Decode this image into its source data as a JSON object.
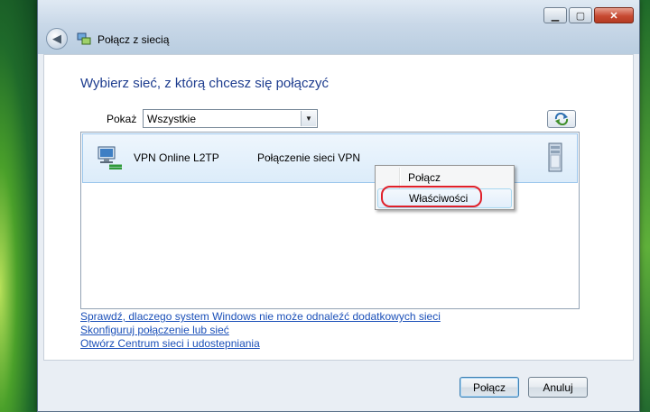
{
  "window": {
    "title": "Połącz z siecią",
    "controls": {
      "minimize": "▁",
      "maximize": "▢",
      "close": "✕"
    }
  },
  "heading": "Wybierz sieć, z którą chcesz się połączyć",
  "filter": {
    "label": "Pokaż",
    "selected": "Wszystkie"
  },
  "networks": [
    {
      "name": "VPN Online L2TP",
      "type": "Połączenie sieci VPN",
      "icon": "vpn-connection-icon"
    }
  ],
  "context_menu": {
    "items": [
      "Połącz",
      "Właściwości"
    ],
    "highlighted": "Właściwości"
  },
  "links": [
    "Sprawdź, dlaczego system Windows nie może odnaleźć dodatkowych sieci",
    "Skonfiguruj połączenie lub sieć",
    "Otwórz Centrum sieci i udostepniania"
  ],
  "buttons": {
    "connect": "Połącz",
    "cancel": "Anuluj"
  },
  "colors": {
    "heading": "#1e3d8f",
    "link": "#1a4fb8",
    "highlight_ring": "#e0202a",
    "selected_row": "#dcecfa"
  }
}
